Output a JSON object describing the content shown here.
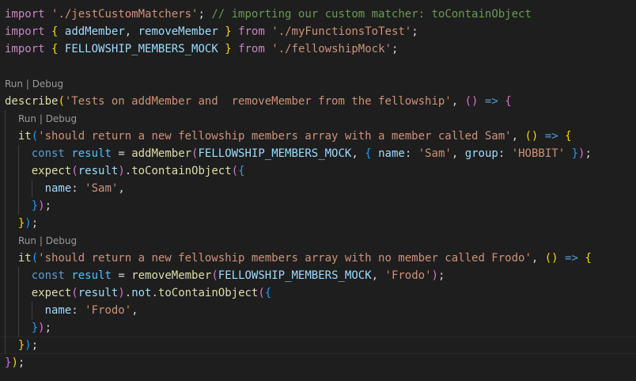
{
  "theme": {
    "background": "#1e1e1e",
    "keyword": "#c586c0",
    "string": "#ce9178",
    "comment": "#6a9955",
    "function": "#dcdcaa",
    "variable": "#9cdcfe",
    "constant": "#4fc1ff",
    "storage": "#569cd6",
    "codelens": "#999999"
  },
  "codelens": {
    "run": "Run",
    "separator": " | ",
    "debug": "Debug"
  },
  "lines": [
    {
      "kind": "code",
      "tokens": [
        {
          "t": "import",
          "c": "kw"
        },
        {
          "t": " ",
          "c": "pl"
        },
        {
          "t": "'./jestCustomMatchers'",
          "c": "st"
        },
        {
          "t": "; ",
          "c": "pl"
        },
        {
          "t": "// importing our custom matcher: toContainObject",
          "c": "cm"
        }
      ]
    },
    {
      "kind": "code",
      "tokens": [
        {
          "t": "import",
          "c": "kw"
        },
        {
          "t": " ",
          "c": "pl"
        },
        {
          "t": "{",
          "c": "br1"
        },
        {
          "t": " ",
          "c": "pl"
        },
        {
          "t": "addMember",
          "c": "var"
        },
        {
          "t": ", ",
          "c": "pl"
        },
        {
          "t": "removeMember",
          "c": "var"
        },
        {
          "t": " ",
          "c": "pl"
        },
        {
          "t": "}",
          "c": "br1"
        },
        {
          "t": " ",
          "c": "pl"
        },
        {
          "t": "from",
          "c": "kw"
        },
        {
          "t": " ",
          "c": "pl"
        },
        {
          "t": "'./myFunctionsToTest'",
          "c": "st"
        },
        {
          "t": ";",
          "c": "pl"
        }
      ]
    },
    {
      "kind": "code",
      "tokens": [
        {
          "t": "import",
          "c": "kw"
        },
        {
          "t": " ",
          "c": "pl"
        },
        {
          "t": "{",
          "c": "br1"
        },
        {
          "t": " ",
          "c": "pl"
        },
        {
          "t": "FELLOWSHIP_MEMBERS_MOCK",
          "c": "var"
        },
        {
          "t": " ",
          "c": "pl"
        },
        {
          "t": "}",
          "c": "br1"
        },
        {
          "t": " ",
          "c": "pl"
        },
        {
          "t": "from",
          "c": "kw"
        },
        {
          "t": " ",
          "c": "pl"
        },
        {
          "t": "'./fellowshipMock'",
          "c": "st"
        },
        {
          "t": ";",
          "c": "pl"
        }
      ]
    },
    {
      "kind": "blank"
    },
    {
      "kind": "lens",
      "indent": 0
    },
    {
      "kind": "code",
      "tokens": [
        {
          "t": "describe",
          "c": "fn"
        },
        {
          "t": "(",
          "c": "br1"
        },
        {
          "t": "'Tests on addMember and  removeMember from the fellowship'",
          "c": "st"
        },
        {
          "t": ", ",
          "c": "pl"
        },
        {
          "t": "()",
          "c": "br2"
        },
        {
          "t": " ",
          "c": "pl"
        },
        {
          "t": "=>",
          "c": "bl"
        },
        {
          "t": " ",
          "c": "pl"
        },
        {
          "t": "{",
          "c": "br2"
        }
      ]
    },
    {
      "kind": "lens",
      "indent": 1
    },
    {
      "kind": "code",
      "tokens": [
        {
          "t": "  ",
          "c": "pl"
        },
        {
          "t": "it",
          "c": "fn"
        },
        {
          "t": "(",
          "c": "br3"
        },
        {
          "t": "'should return a new fellowship members array with a member called Sam'",
          "c": "st"
        },
        {
          "t": ", ",
          "c": "pl"
        },
        {
          "t": "()",
          "c": "br1"
        },
        {
          "t": " ",
          "c": "pl"
        },
        {
          "t": "=>",
          "c": "bl"
        },
        {
          "t": " ",
          "c": "pl"
        },
        {
          "t": "{",
          "c": "br1"
        }
      ]
    },
    {
      "kind": "code",
      "tokens": [
        {
          "t": "    ",
          "c": "pl"
        },
        {
          "t": "const",
          "c": "bl"
        },
        {
          "t": " ",
          "c": "pl"
        },
        {
          "t": "result",
          "c": "cn"
        },
        {
          "t": " = ",
          "c": "pl"
        },
        {
          "t": "addMember",
          "c": "fn"
        },
        {
          "t": "(",
          "c": "br2"
        },
        {
          "t": "FELLOWSHIP_MEMBERS_MOCK",
          "c": "var"
        },
        {
          "t": ", ",
          "c": "pl"
        },
        {
          "t": "{",
          "c": "br3"
        },
        {
          "t": " ",
          "c": "pl"
        },
        {
          "t": "name",
          "c": "var"
        },
        {
          "t": ": ",
          "c": "pl"
        },
        {
          "t": "'Sam'",
          "c": "st"
        },
        {
          "t": ", ",
          "c": "pl"
        },
        {
          "t": "group",
          "c": "var"
        },
        {
          "t": ": ",
          "c": "pl"
        },
        {
          "t": "'HOBBIT'",
          "c": "st"
        },
        {
          "t": " ",
          "c": "pl"
        },
        {
          "t": "}",
          "c": "br3"
        },
        {
          "t": ")",
          "c": "br2"
        },
        {
          "t": ";",
          "c": "pl"
        }
      ]
    },
    {
      "kind": "code",
      "tokens": [
        {
          "t": "    ",
          "c": "pl"
        },
        {
          "t": "expect",
          "c": "fn"
        },
        {
          "t": "(",
          "c": "br2"
        },
        {
          "t": "result",
          "c": "var"
        },
        {
          "t": ")",
          "c": "br2"
        },
        {
          "t": ".",
          "c": "pl"
        },
        {
          "t": "toContainObject",
          "c": "fn"
        },
        {
          "t": "(",
          "c": "br2"
        },
        {
          "t": "{",
          "c": "br3"
        }
      ]
    },
    {
      "kind": "code",
      "tokens": [
        {
          "t": "      ",
          "c": "pl"
        },
        {
          "t": "name",
          "c": "var"
        },
        {
          "t": ": ",
          "c": "pl"
        },
        {
          "t": "'Sam'",
          "c": "st"
        },
        {
          "t": ",",
          "c": "pl"
        }
      ]
    },
    {
      "kind": "code",
      "tokens": [
        {
          "t": "    ",
          "c": "pl"
        },
        {
          "t": "}",
          "c": "br3"
        },
        {
          "t": ")",
          "c": "br2"
        },
        {
          "t": ";",
          "c": "pl"
        }
      ]
    },
    {
      "kind": "code",
      "tokens": [
        {
          "t": "  ",
          "c": "pl"
        },
        {
          "t": "}",
          "c": "br1"
        },
        {
          "t": ")",
          "c": "br3"
        },
        {
          "t": ";",
          "c": "pl"
        }
      ]
    },
    {
      "kind": "lens",
      "indent": 1
    },
    {
      "kind": "code",
      "tokens": [
        {
          "t": "  ",
          "c": "pl"
        },
        {
          "t": "it",
          "c": "fn"
        },
        {
          "t": "(",
          "c": "br3"
        },
        {
          "t": "'should return a new fellowship members array with no member called Frodo'",
          "c": "st"
        },
        {
          "t": ", ",
          "c": "pl"
        },
        {
          "t": "()",
          "c": "br1"
        },
        {
          "t": " ",
          "c": "pl"
        },
        {
          "t": "=>",
          "c": "bl"
        },
        {
          "t": " ",
          "c": "pl"
        },
        {
          "t": "{",
          "c": "br1"
        }
      ]
    },
    {
      "kind": "code",
      "tokens": [
        {
          "t": "    ",
          "c": "pl"
        },
        {
          "t": "const",
          "c": "bl"
        },
        {
          "t": " ",
          "c": "pl"
        },
        {
          "t": "result",
          "c": "cn"
        },
        {
          "t": " = ",
          "c": "pl"
        },
        {
          "t": "removeMember",
          "c": "fn"
        },
        {
          "t": "(",
          "c": "br2"
        },
        {
          "t": "FELLOWSHIP_MEMBERS_MOCK",
          "c": "var"
        },
        {
          "t": ", ",
          "c": "pl"
        },
        {
          "t": "'Frodo'",
          "c": "st"
        },
        {
          "t": ")",
          "c": "br2"
        },
        {
          "t": ";",
          "c": "pl"
        }
      ]
    },
    {
      "kind": "code",
      "tokens": [
        {
          "t": "    ",
          "c": "pl"
        },
        {
          "t": "expect",
          "c": "fn"
        },
        {
          "t": "(",
          "c": "br2"
        },
        {
          "t": "result",
          "c": "var"
        },
        {
          "t": ")",
          "c": "br2"
        },
        {
          "t": ".",
          "c": "pl"
        },
        {
          "t": "not",
          "c": "var"
        },
        {
          "t": ".",
          "c": "pl"
        },
        {
          "t": "toContainObject",
          "c": "fn"
        },
        {
          "t": "(",
          "c": "br2"
        },
        {
          "t": "{",
          "c": "br3"
        }
      ]
    },
    {
      "kind": "code",
      "tokens": [
        {
          "t": "      ",
          "c": "pl"
        },
        {
          "t": "name",
          "c": "var"
        },
        {
          "t": ": ",
          "c": "pl"
        },
        {
          "t": "'Frodo'",
          "c": "st"
        },
        {
          "t": ",",
          "c": "pl"
        }
      ]
    },
    {
      "kind": "code",
      "tokens": [
        {
          "t": "    ",
          "c": "pl"
        },
        {
          "t": "}",
          "c": "br3"
        },
        {
          "t": ")",
          "c": "br2"
        },
        {
          "t": ";",
          "c": "pl"
        }
      ]
    },
    {
      "kind": "code",
      "current": true,
      "tokens": [
        {
          "t": "  ",
          "c": "pl"
        },
        {
          "t": "}",
          "c": "br1"
        },
        {
          "t": ")",
          "c": "br3"
        },
        {
          "t": ";",
          "c": "pl"
        }
      ]
    },
    {
      "kind": "code",
      "tokens": [
        {
          "t": "}",
          "c": "br2"
        },
        {
          "t": ")",
          "c": "br1"
        },
        {
          "t": ";",
          "c": "pl"
        }
      ]
    }
  ]
}
